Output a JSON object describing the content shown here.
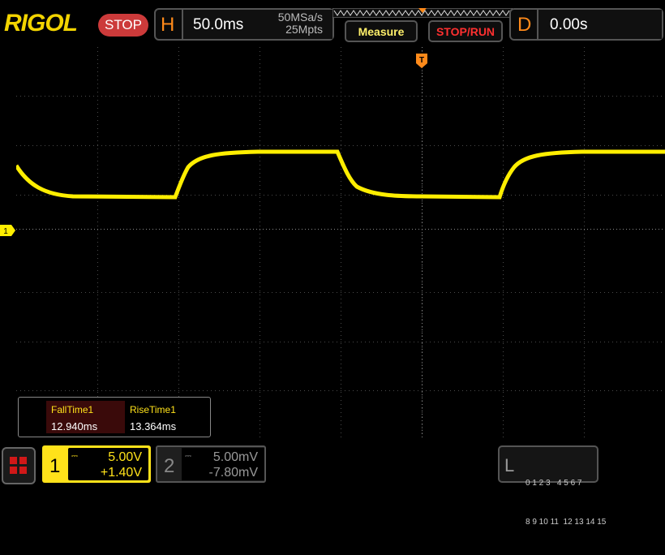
{
  "brand": "RIGOL",
  "run_state": "STOP",
  "horizontal": {
    "letter": "H",
    "timebase": "50.0ms",
    "sample_rate": "50MSa/s",
    "memory_depth": "25Mpts"
  },
  "buttons": {
    "measure": "Measure",
    "stop_run": "STOP/RUN"
  },
  "delay": {
    "letter": "D",
    "value": "0.00s"
  },
  "trigger_marker": "T",
  "channel_marker": "1",
  "measurements": [
    {
      "name": "FallTime1",
      "value": "12.940ms"
    },
    {
      "name": "RiseTime1",
      "value": "13.364ms"
    }
  ],
  "channel1": {
    "number": "1",
    "coupling_symbol": "⎓",
    "scale": "5.00V",
    "offset": "+1.40V",
    "color": "#ffe21a"
  },
  "channel2": {
    "number": "2",
    "coupling_symbol": "⎓",
    "scale": "5.00mV",
    "offset": "-7.80mV",
    "color": "#888888"
  },
  "logic": {
    "letter": "L",
    "row1": "0 1 2 3   4 5 6 7",
    "row2": "8 9 10 11  12 13 14 15"
  },
  "colors": {
    "trace": "#ffee00",
    "accent_orange": "#ff8a1a",
    "stop_red": "#cc3a3a",
    "grid": "#555555"
  }
}
